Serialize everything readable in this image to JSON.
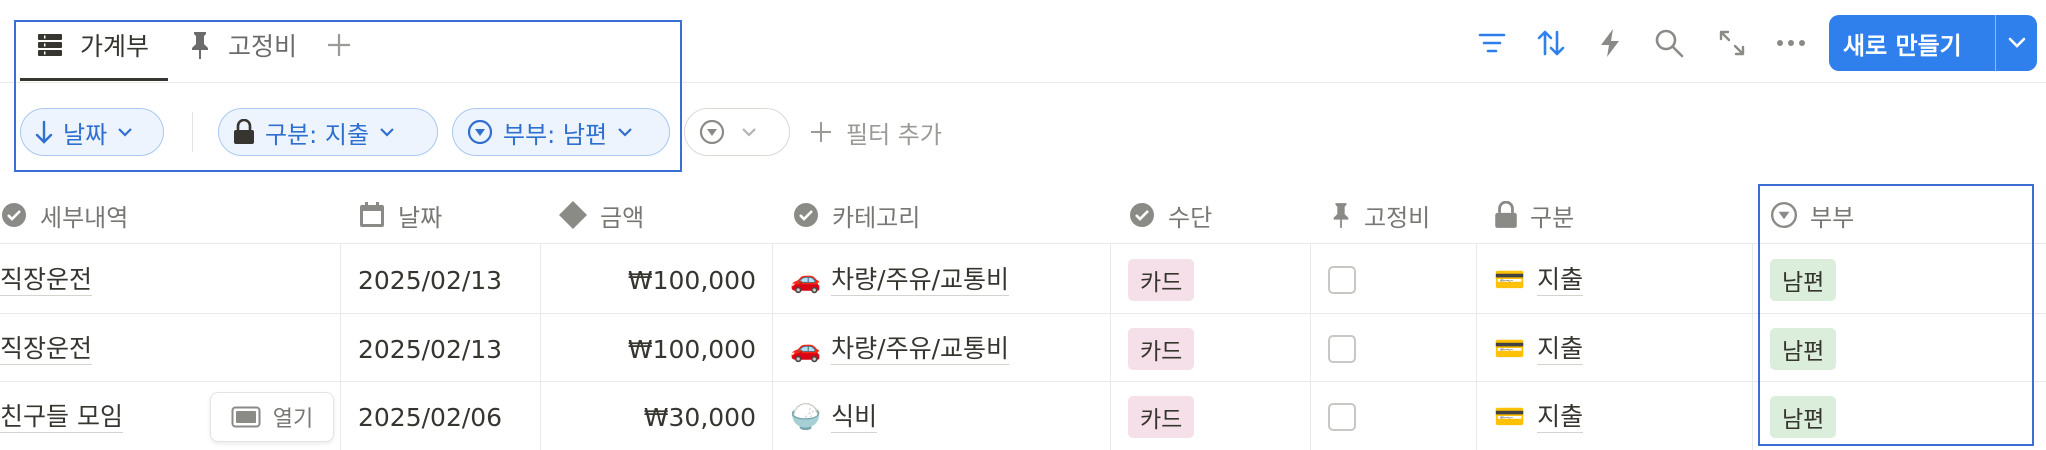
{
  "tabs": [
    {
      "label": "가계부",
      "icon": "table-icon",
      "active": true
    },
    {
      "label": "고정비",
      "icon": "pin-icon",
      "active": false
    }
  ],
  "toolbar": {
    "new_button_label": "새로 만들기",
    "accent": "#2f80ed"
  },
  "filters": {
    "sort": "날짜",
    "f1": "구분: 지출",
    "f2": "부부: 남편",
    "add_filter": "필터 추가"
  },
  "table": {
    "columns": [
      "세부내역",
      "날짜",
      "금액",
      "카테고리",
      "수단",
      "고정비",
      "구분",
      "부부"
    ],
    "rows": [
      {
        "detail": "직장운전",
        "date": "2025/02/13",
        "amount": "₩100,000",
        "category": "차량/주유/교통비",
        "category_icon": "🚗",
        "method": "카드",
        "fixed": false,
        "division": "지출",
        "division_icon": "💳",
        "couple": "남편"
      },
      {
        "detail": "직장운전",
        "date": "2025/02/13",
        "amount": "₩100,000",
        "category": "차량/주유/교통비",
        "category_icon": "🚗",
        "method": "카드",
        "fixed": false,
        "division": "지출",
        "division_icon": "💳",
        "couple": "남편"
      },
      {
        "detail": "친구들 모임",
        "date": "2025/02/06",
        "amount": "₩30,000",
        "category": "식비",
        "category_icon": "🍚",
        "method": "카드",
        "fixed": false,
        "division": "지출",
        "division_icon": "💳",
        "couple": "남편"
      }
    ],
    "open_label": "열기"
  }
}
